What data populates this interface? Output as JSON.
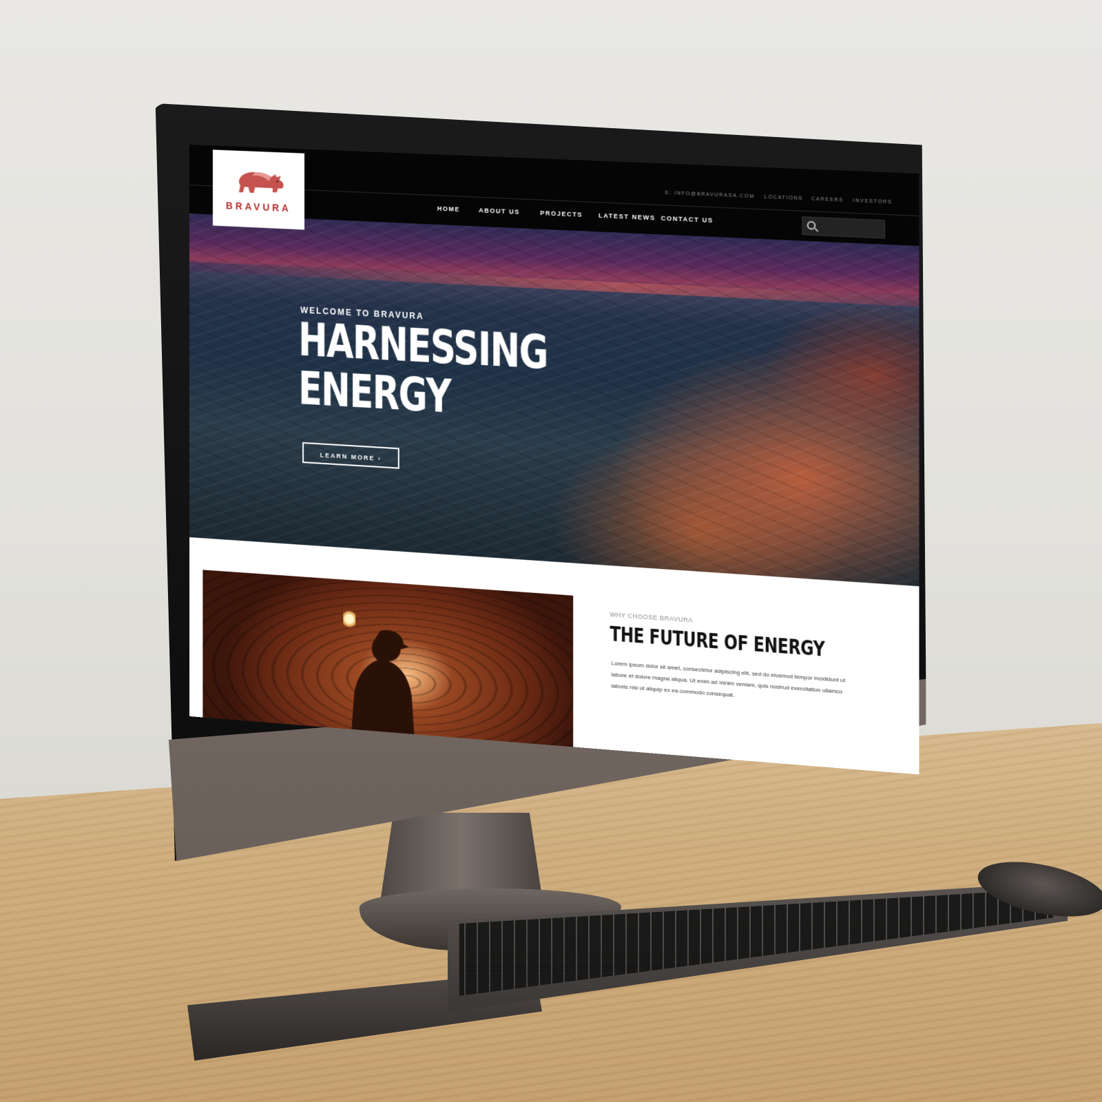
{
  "site": {
    "top_bar": {
      "email": "E: INFO@BRAVURASA.COM",
      "links": [
        "LOCATIONS",
        "CAREERS",
        "INVESTORS"
      ]
    },
    "logo": {
      "text": "BRAVURA",
      "icon": "rhino-logo-icon",
      "color": "#b4302f"
    },
    "nav": {
      "items": [
        "HOME",
        "ABOUT US",
        "PROJECTS",
        "LATEST NEWS",
        "CONTACT US"
      ]
    },
    "search": {
      "icon": "search-icon",
      "placeholder": ""
    },
    "hero": {
      "kicker": "WELCOME TO BRAVURA",
      "title_line1": "HARNESSING",
      "title_line2": "ENERGY",
      "button_label": "LEARN MORE ›"
    },
    "section": {
      "kicker": "WHY CHOOSE BRAVURA",
      "title": "THE FUTURE OF ENERGY",
      "body": "Lorem ipsum dolor sit amet, consectetur adipiscing elit, sed do eiusmod tempor incididunt ut labore et dolore magna aliqua. Ut enim ad minim veniam, quis nostrud exercitation ullamco laboris nisi ut aliquip ex ea commodo consequat."
    }
  }
}
